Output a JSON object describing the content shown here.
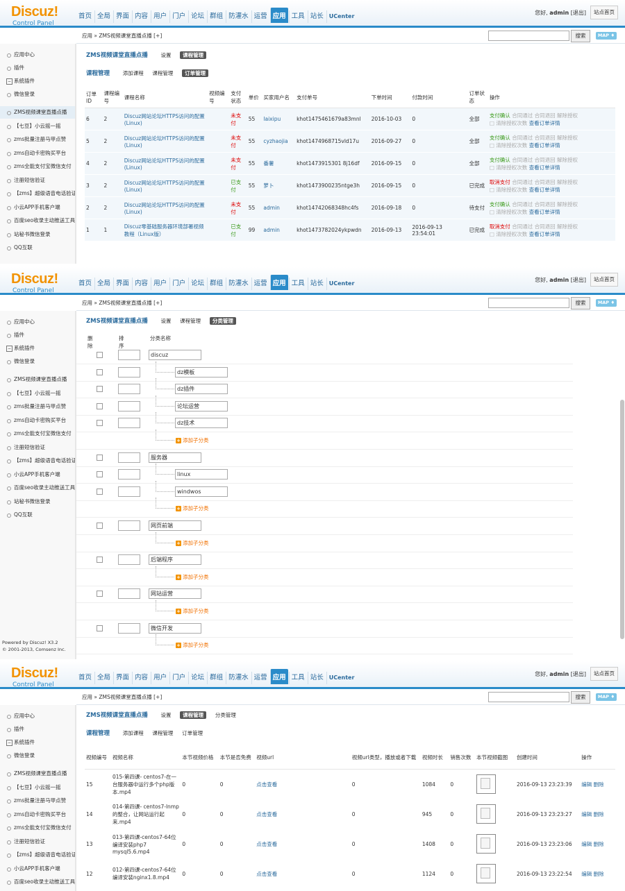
{
  "header": {
    "logo_main": "Discuz!",
    "logo_sub": "Control Panel",
    "nav": [
      "首页",
      "全局",
      "界面",
      "内容",
      "用户",
      "门户",
      "论坛",
      "群组",
      "防灌水",
      "运营",
      "应用",
      "工具",
      "站长",
      "UCenter"
    ],
    "active_nav": "应用",
    "greeting": "您好,",
    "user": "admin",
    "logout": "[退出]",
    "site_home": "站点首页"
  },
  "crumb": {
    "path": "应用 » ZMS视频课堂直播点播",
    "plus": "[+]",
    "search_btn": "搜索",
    "map_btn": "MAP ♦"
  },
  "sidebar": {
    "items": [
      "应用中心",
      "插件",
      "系统插件",
      "微信登录",
      "ZMS视频课堂直播点播",
      "【七豆】小云摇一摇",
      "zms批量注册马甲点赞",
      "zms自动卡密购买平台",
      "zms全能支付宝微信支付",
      "注册短信验证",
      "【zms】超级语音电话验证",
      "小云APP手机客户端",
      "百度seo收录主动推送工具",
      "站秘书微信登录",
      "QQ互联"
    ],
    "footer_line1": "Powered by Discuz! X3.2",
    "footer_line2": "© 2001-2013, Comsenz Inc."
  },
  "plugin": {
    "title": "ZMS视频课堂直播点播",
    "tab_settings": "设置",
    "tab_course": "课程管理",
    "tab_category": "分类管理",
    "sub_title": "课程管理",
    "sub_add": "添加课程",
    "sub_course": "课程管理",
    "sub_orders": "订单管理"
  },
  "orders": {
    "headers": [
      "订单ID",
      "课程编号",
      "课程名称",
      "视频编号",
      "支付状态",
      "单价",
      "买家用户名",
      "支付单号",
      "下单时间",
      "付款时间",
      "订单状态",
      "操作"
    ],
    "rows": [
      {
        "id": "6",
        "course": "2",
        "name": "Discuz网站论坛HTTPS访问的配置(Linux)",
        "video": "",
        "pay": "未支付",
        "price": "55",
        "buyer": "laixipu",
        "no": "khot1475461679a83mnl",
        "time": "2016-10-03",
        "paytime": "0",
        "status": "全部",
        "a1": "支付确认",
        "a2": "合同通过",
        "a3": "合同退回",
        "a4": "解除授权",
        "a5": "清除授权次数",
        "a6": "查看订单详情"
      },
      {
        "id": "5",
        "course": "2",
        "name": "Discuz网站论坛HTTPS访问的配置(Linux)",
        "video": "",
        "pay": "未支付",
        "price": "55",
        "buyer": "cyzhaojia",
        "no": "khot1474968715vld17u",
        "time": "2016-09-27",
        "paytime": "0",
        "status": "全部",
        "a1": "支付确认",
        "a2": "合同通过",
        "a3": "合同退回",
        "a4": "解除授权",
        "a5": "清除授权次数",
        "a6": "查看订单详情"
      },
      {
        "id": "4",
        "course": "2",
        "name": "Discuz网站论坛HTTPS访问的配置(Linux)",
        "video": "",
        "pay": "未支付",
        "price": "55",
        "buyer": "番薯",
        "no": "khot1473915301 8j16df",
        "time": "2016-09-15",
        "paytime": "0",
        "status": "全部",
        "a1": "支付确认",
        "a2": "合同通过",
        "a3": "合同退回",
        "a4": "解除授权",
        "a5": "清除授权次数",
        "a6": "查看订单详情"
      },
      {
        "id": "3",
        "course": "2",
        "name": "Discuz网站论坛HTTPS访问的配置(Linux)",
        "video": "",
        "pay": "已支付",
        "price": "55",
        "buyer": "萝卜",
        "no": "khot1473900235ntge3h",
        "time": "2016-09-15",
        "paytime": "0",
        "status": "已完成",
        "a1": "取消支付",
        "a2": "合同通过",
        "a3": "合同退回",
        "a4": "解除授权",
        "a5": "清除授权次数",
        "a6": "查看订单详情"
      },
      {
        "id": "2",
        "course": "2",
        "name": "Discuz网站论坛HTTPS访问的配置(Linux)",
        "video": "",
        "pay": "未支付",
        "price": "55",
        "buyer": "admin",
        "no": "khot14742068348hc4fs",
        "time": "2016-09-18",
        "paytime": "0",
        "status": "待支付",
        "a1": "支付确认",
        "a2": "合同通过",
        "a3": "合同退回",
        "a4": "解除授权",
        "a5": "清除授权次数",
        "a6": "查看订单详情"
      },
      {
        "id": "1",
        "course": "1",
        "name": "Discuz零基础服务器环境部署视频教程（Linux版）",
        "video": "",
        "pay": "已支付",
        "price": "99",
        "buyer": "admin",
        "no": "khot1473782024ykpwdn",
        "time": "2016-09-13",
        "paytime": "2016-09-13 23:54:01",
        "status": "已完成",
        "a1": "取消支付",
        "a2": "合同通过",
        "a3": "合同退回",
        "a4": "解除授权",
        "a5": "清除授权次数",
        "a6": "查看订单详情"
      }
    ]
  },
  "categories": {
    "headers": [
      "删除",
      "排序",
      "分类名称"
    ],
    "add_sub": "添加子分类",
    "groups": [
      {
        "name": "discuz",
        "children": [
          "dz模板",
          "dz插件",
          "论坛运营",
          "dz技术"
        ]
      },
      {
        "name": "服务器",
        "children": [
          "linux",
          "windwos"
        ]
      },
      {
        "name": "网页前端",
        "children": []
      },
      {
        "name": "后端程序",
        "children": []
      },
      {
        "name": "网站运营",
        "children": []
      },
      {
        "name": "微信开发",
        "children": []
      }
    ]
  },
  "videos": {
    "headers": [
      "视频编号",
      "视频名称",
      "本节视频价格",
      "本节是否免费",
      "视频url",
      "视频url类型，播放或者下载",
      "视频时长",
      "销售次数",
      "本节视频截图",
      "创建时间",
      "操作"
    ],
    "view_link": "点击查看",
    "edit": "编辑",
    "del": "删除",
    "rows": [
      {
        "id": "15",
        "name": "015-第四课- centos7-在一台服务器中运行多个php版本.mp4",
        "price": "0",
        "free": "0",
        "type": "0",
        "dur": "1084",
        "sales": "0",
        "created": "2016-09-13 23:23:39"
      },
      {
        "id": "14",
        "name": "014-第四课- centos7-lnmp的整合，让网站运行起来.mp4",
        "price": "0",
        "free": "0",
        "type": "0",
        "dur": "945",
        "sales": "0",
        "created": "2016-09-13 23:23:27"
      },
      {
        "id": "13",
        "name": "013-第四课-centos7-64位编译安装php7 mysql5.6.mp4",
        "price": "0",
        "free": "0",
        "type": "0",
        "dur": "1408",
        "sales": "0",
        "created": "2016-09-13 23:23:06"
      },
      {
        "id": "12",
        "name": "012-第四课-centos7-64位编译安装nginx1.8.mp4",
        "price": "0",
        "free": "0",
        "type": "0",
        "dur": "1124",
        "sales": "0",
        "created": "2016-09-13 23:22:54"
      }
    ]
  }
}
